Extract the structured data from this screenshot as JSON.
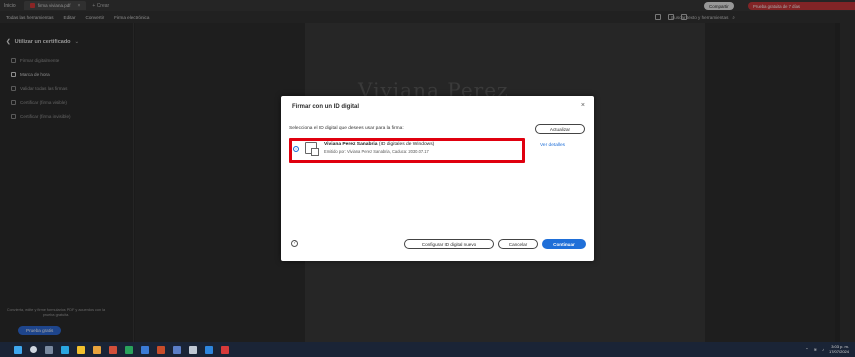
{
  "top_bar": {
    "home_label": "Inicio",
    "tab_title": "firma viviana.pdf",
    "new_tab_label": "Crear",
    "sign_in_label": "Iniciar sesión"
  },
  "menu_bar": {
    "items": [
      "Todas las herramientas",
      "Editar",
      "Convertir",
      "Firma electrónica"
    ],
    "search_label": "Buscar texto y herramientas",
    "share_label": "Compartir",
    "trial_label": "Prueba gratuita de 7 días"
  },
  "sidebar": {
    "title": "Utilizar un certificado",
    "items": [
      {
        "label": "Firmar digitalmente",
        "active": false
      },
      {
        "label": "Marca de hora",
        "active": true
      },
      {
        "label": "Validar todas las firmas",
        "active": false
      },
      {
        "label": "Certificar (firma visible)",
        "active": false
      },
      {
        "label": "Certificar (firma invisible)",
        "active": false
      }
    ],
    "promo_text": "Convierta, edite y firme formularios PDF y acuerdos con la prueba gratuita.",
    "try_button": "Prueba gratis"
  },
  "document": {
    "signature_text": "Viviana Perez"
  },
  "dialog": {
    "title": "Firmar con un ID digital",
    "prompt": "Selecciona el ID digital que desees usar para la firma:",
    "refresh_button": "Actualizar",
    "certificate": {
      "name": "Viviana Perez Sanabria",
      "type": "(ID digitales de Windows)",
      "issuer": "Emitido por: Viviana Perez Sanabria, Caduca: 2030.07.17",
      "selected": true
    },
    "details_link": "Ver detalles",
    "configure_button": "Configurar ID digital nuevo",
    "cancel_button": "Cancelar",
    "continue_button": "Continuar"
  },
  "taskbar": {
    "time": "3:03 p. m.",
    "date": "17/07/2024"
  },
  "colors": {
    "accent": "#1f6fd8",
    "highlight_box": "#e0000f",
    "trial_red": "#c8383b"
  }
}
